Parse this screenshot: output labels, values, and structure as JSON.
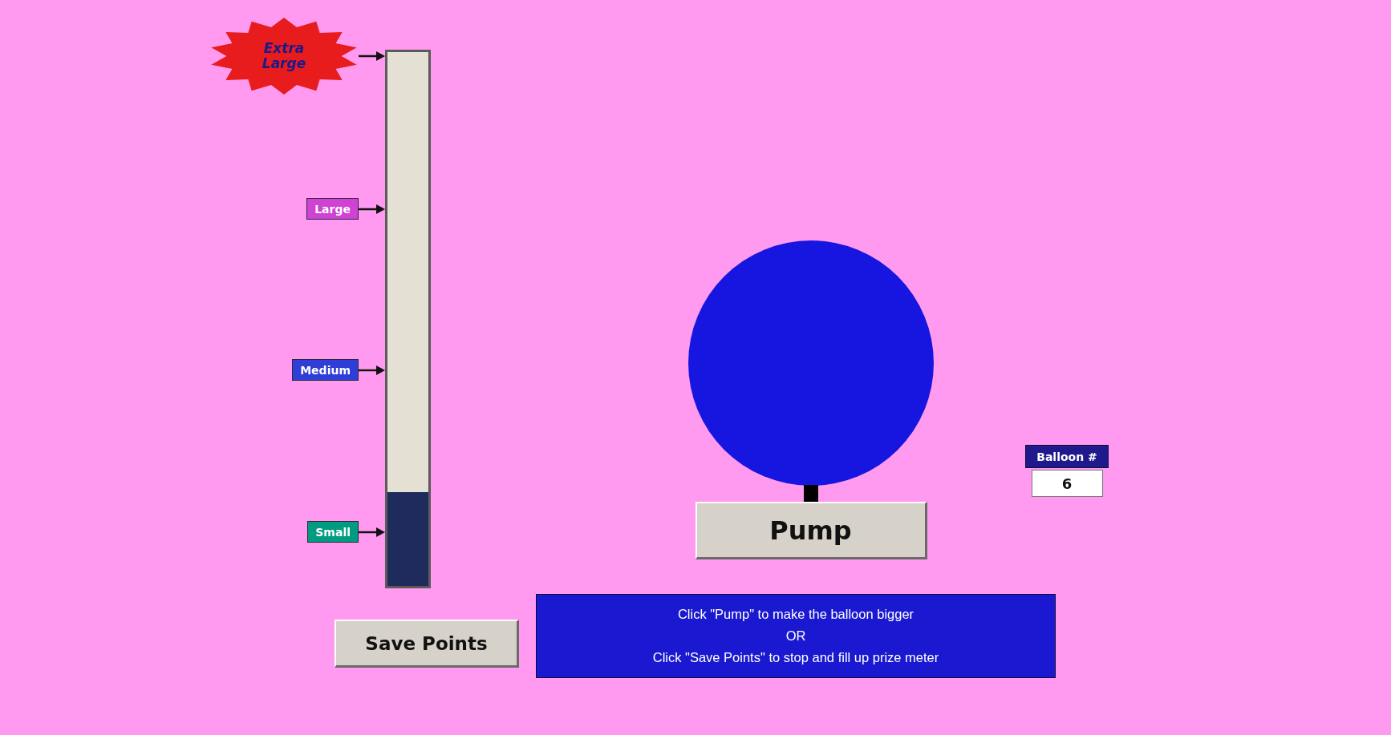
{
  "prize_meter": {
    "level": 0.175,
    "markers": [
      {
        "kind": "starburst",
        "label": "Extra Large",
        "color": "#e81c1c"
      },
      {
        "kind": "tag",
        "label": "Large",
        "color": "#d042d4"
      },
      {
        "kind": "tag",
        "label": "Medium",
        "color": "#2e3ed6"
      },
      {
        "kind": "tag",
        "label": "Small",
        "color": "#009b80"
      }
    ]
  },
  "pump_button": {
    "label": "Pump"
  },
  "balloon_counter": {
    "label": "Balloon #",
    "value": "6"
  },
  "save_button": {
    "label": "Save Points"
  },
  "instructions": {
    "lines": [
      "Click \"Pump\" to make the balloon bigger",
      "OR",
      "Click \"Save Points\" to stop and fill up prize meter"
    ]
  }
}
